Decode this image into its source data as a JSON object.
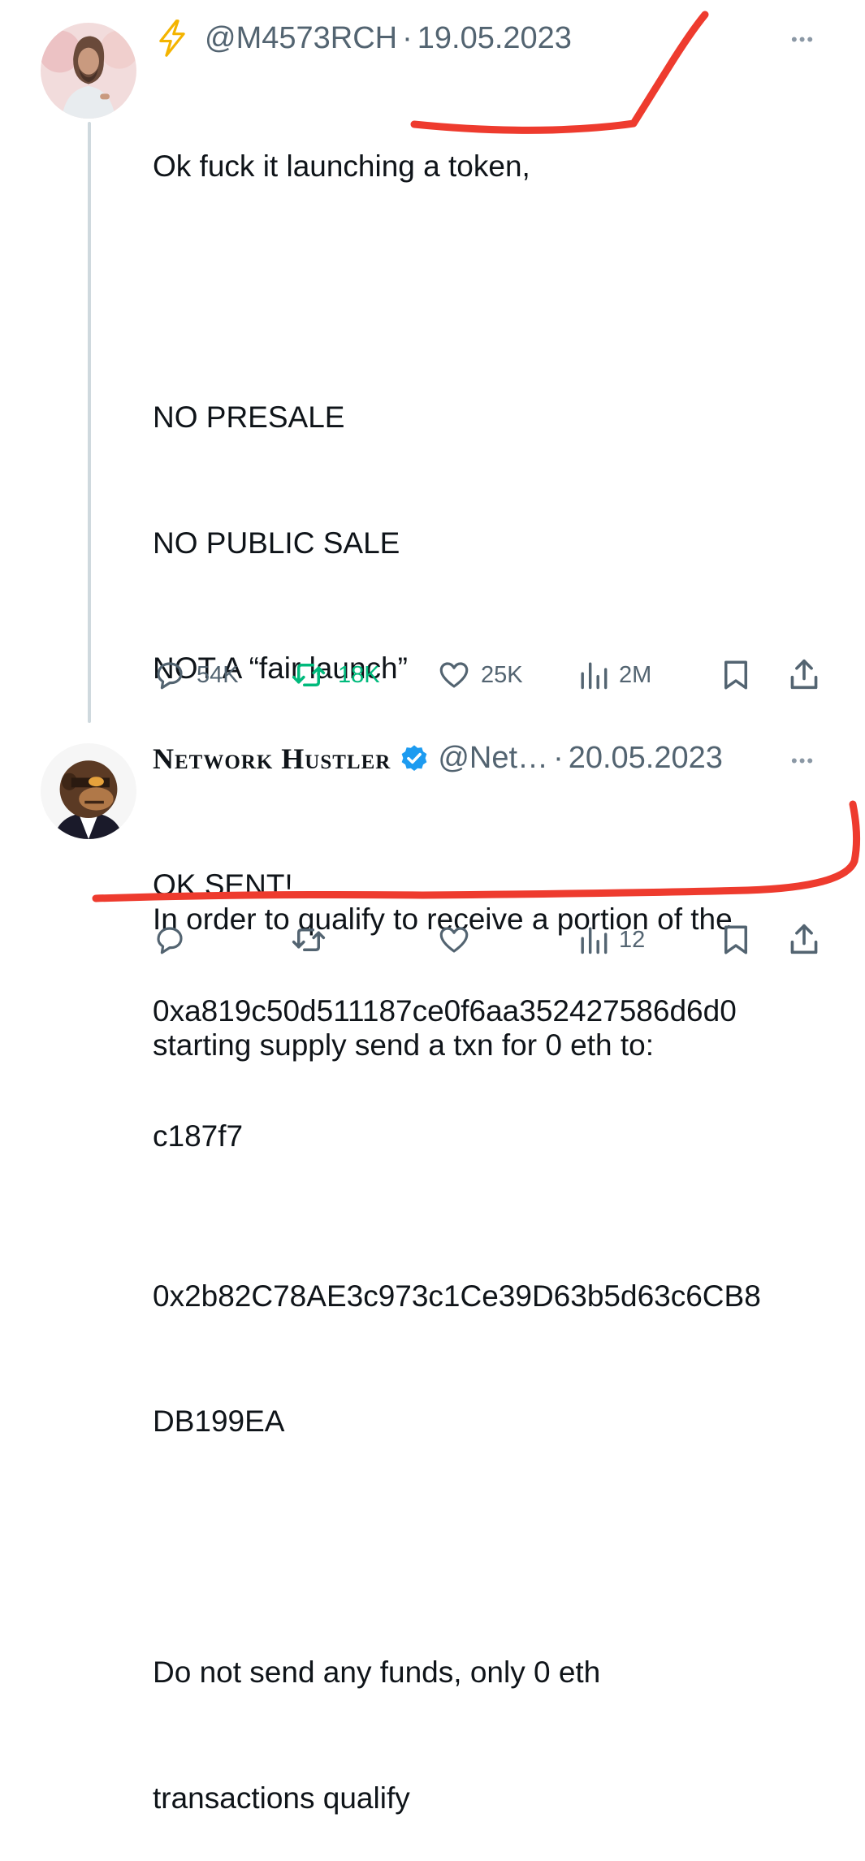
{
  "tweets": [
    {
      "prefix_icon": "lightning-icon",
      "handle": "@M4573RCH",
      "separator": "·",
      "date": "19.05.2023",
      "more": "•••",
      "lines": [
        "Ok fuck it launching a token,",
        "",
        "NO PRESALE",
        "NO PUBLIC SALE",
        "NOT A “fair launch”",
        "",
        "In order to qualify to receive a portion of the",
        "starting supply send a txn for 0 eth to:",
        "",
        "0x2b82C78AE3c973c1Ce39D63b5d63c6CB8",
        "DB199EA",
        "",
        "Do not send any funds, only 0 eth",
        "transactions qualify"
      ],
      "actions": {
        "replies": "54K",
        "reposts": "18K",
        "likes": "25K",
        "views": "2M"
      }
    },
    {
      "display_name": "Network Hustler",
      "verified_icon": "verified-badge-icon",
      "handle": "@Net…",
      "separator": "·",
      "date": "20.05.2023",
      "more": "•••",
      "lines": [
        "OK SENT!",
        "0xa819c50d511187ce0f6aa352427586d6d0",
        "c187f7"
      ],
      "actions": {
        "replies": "",
        "reposts": "",
        "likes": "",
        "views": "12"
      }
    }
  ],
  "colors": {
    "text": "#0f1419",
    "secondary": "#536471",
    "repost_active": "#00ba7c",
    "verified": "#1d9bf0",
    "annotation": "#ee3b2e",
    "lightning": "#f4b400"
  }
}
